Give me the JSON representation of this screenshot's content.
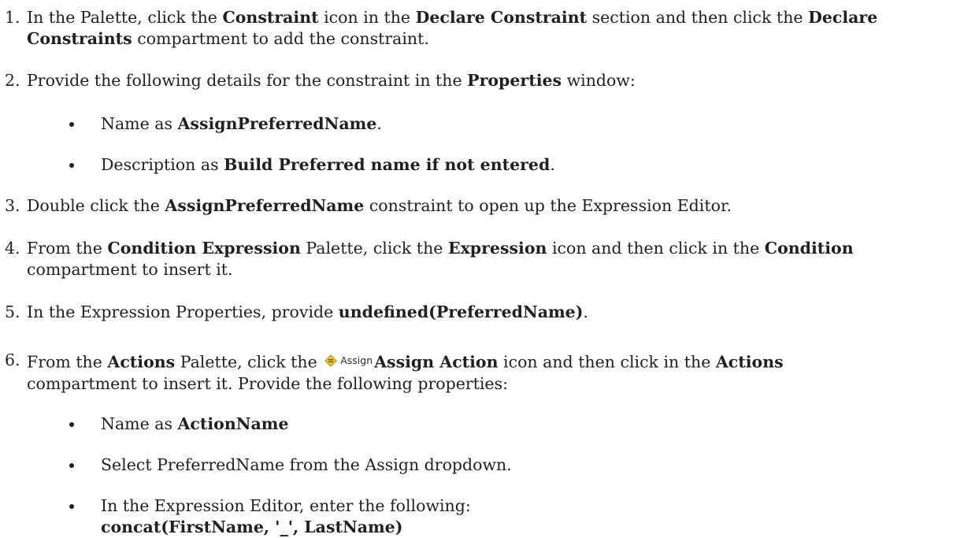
{
  "steps": [
    {
      "number": "1.",
      "line1": {
        "t1": "In the Palette, click the ",
        "b1": "Constraint",
        "t2": " icon in the ",
        "b2": "Declare Constraint",
        "t3": " section and then click the ",
        "b3": "Declare"
      },
      "line2": {
        "b1": "Constraints",
        "t1": " compartment to add the constraint."
      }
    },
    {
      "number": "2.",
      "t1": "Provide the following details for the constraint in the ",
      "b1": "Properties",
      "t2": " window:",
      "bullets": [
        {
          "t1": "Name as ",
          "b1": "AssignPreferredName",
          "t2": "."
        },
        {
          "t1": "Description as ",
          "b1": "Build Preferred name if not entered",
          "t2": "."
        }
      ]
    },
    {
      "number": "3.",
      "t1": "Double click the ",
      "b1": "AssignPreferredName",
      "t2": " constraint to open up the Expression Editor."
    },
    {
      "number": "4.",
      "line1": {
        "t1": "From the ",
        "b1": "Condition Expression",
        "t2": " Palette, click the ",
        "b2": "Expression",
        "t3": " icon and then click in the ",
        "b3": "Condition"
      },
      "line2": {
        "t1": "compartment to insert it."
      }
    },
    {
      "number": "5.",
      "t1": "In the Expression Properties, provide ",
      "b1": "undefined(PreferredName)",
      "t2": "."
    },
    {
      "number": "6.",
      "line1": {
        "t1": "From the ",
        "b1": "Actions",
        "t2": " Palette, click the ",
        "icon_label": "Assign",
        "b2": "Assign Action",
        "t3": " icon and then click in the ",
        "b3": "Actions"
      },
      "line2": {
        "t1": "compartment to insert it. Provide the following properties:"
      },
      "bullets": [
        {
          "t1": "Name as ",
          "b1": "ActionName"
        },
        {
          "t1": "Select PreferredName from the Assign dropdown."
        },
        {
          "t1": "In the Expression Editor, enter the following:",
          "b1": "concat(FirstName, '_', LastName)"
        }
      ]
    }
  ],
  "icons": {
    "assign_action": "assign-diamond-icon",
    "assign_icon_fill": "#f3c623",
    "assign_icon_stroke": "#b8860b"
  }
}
